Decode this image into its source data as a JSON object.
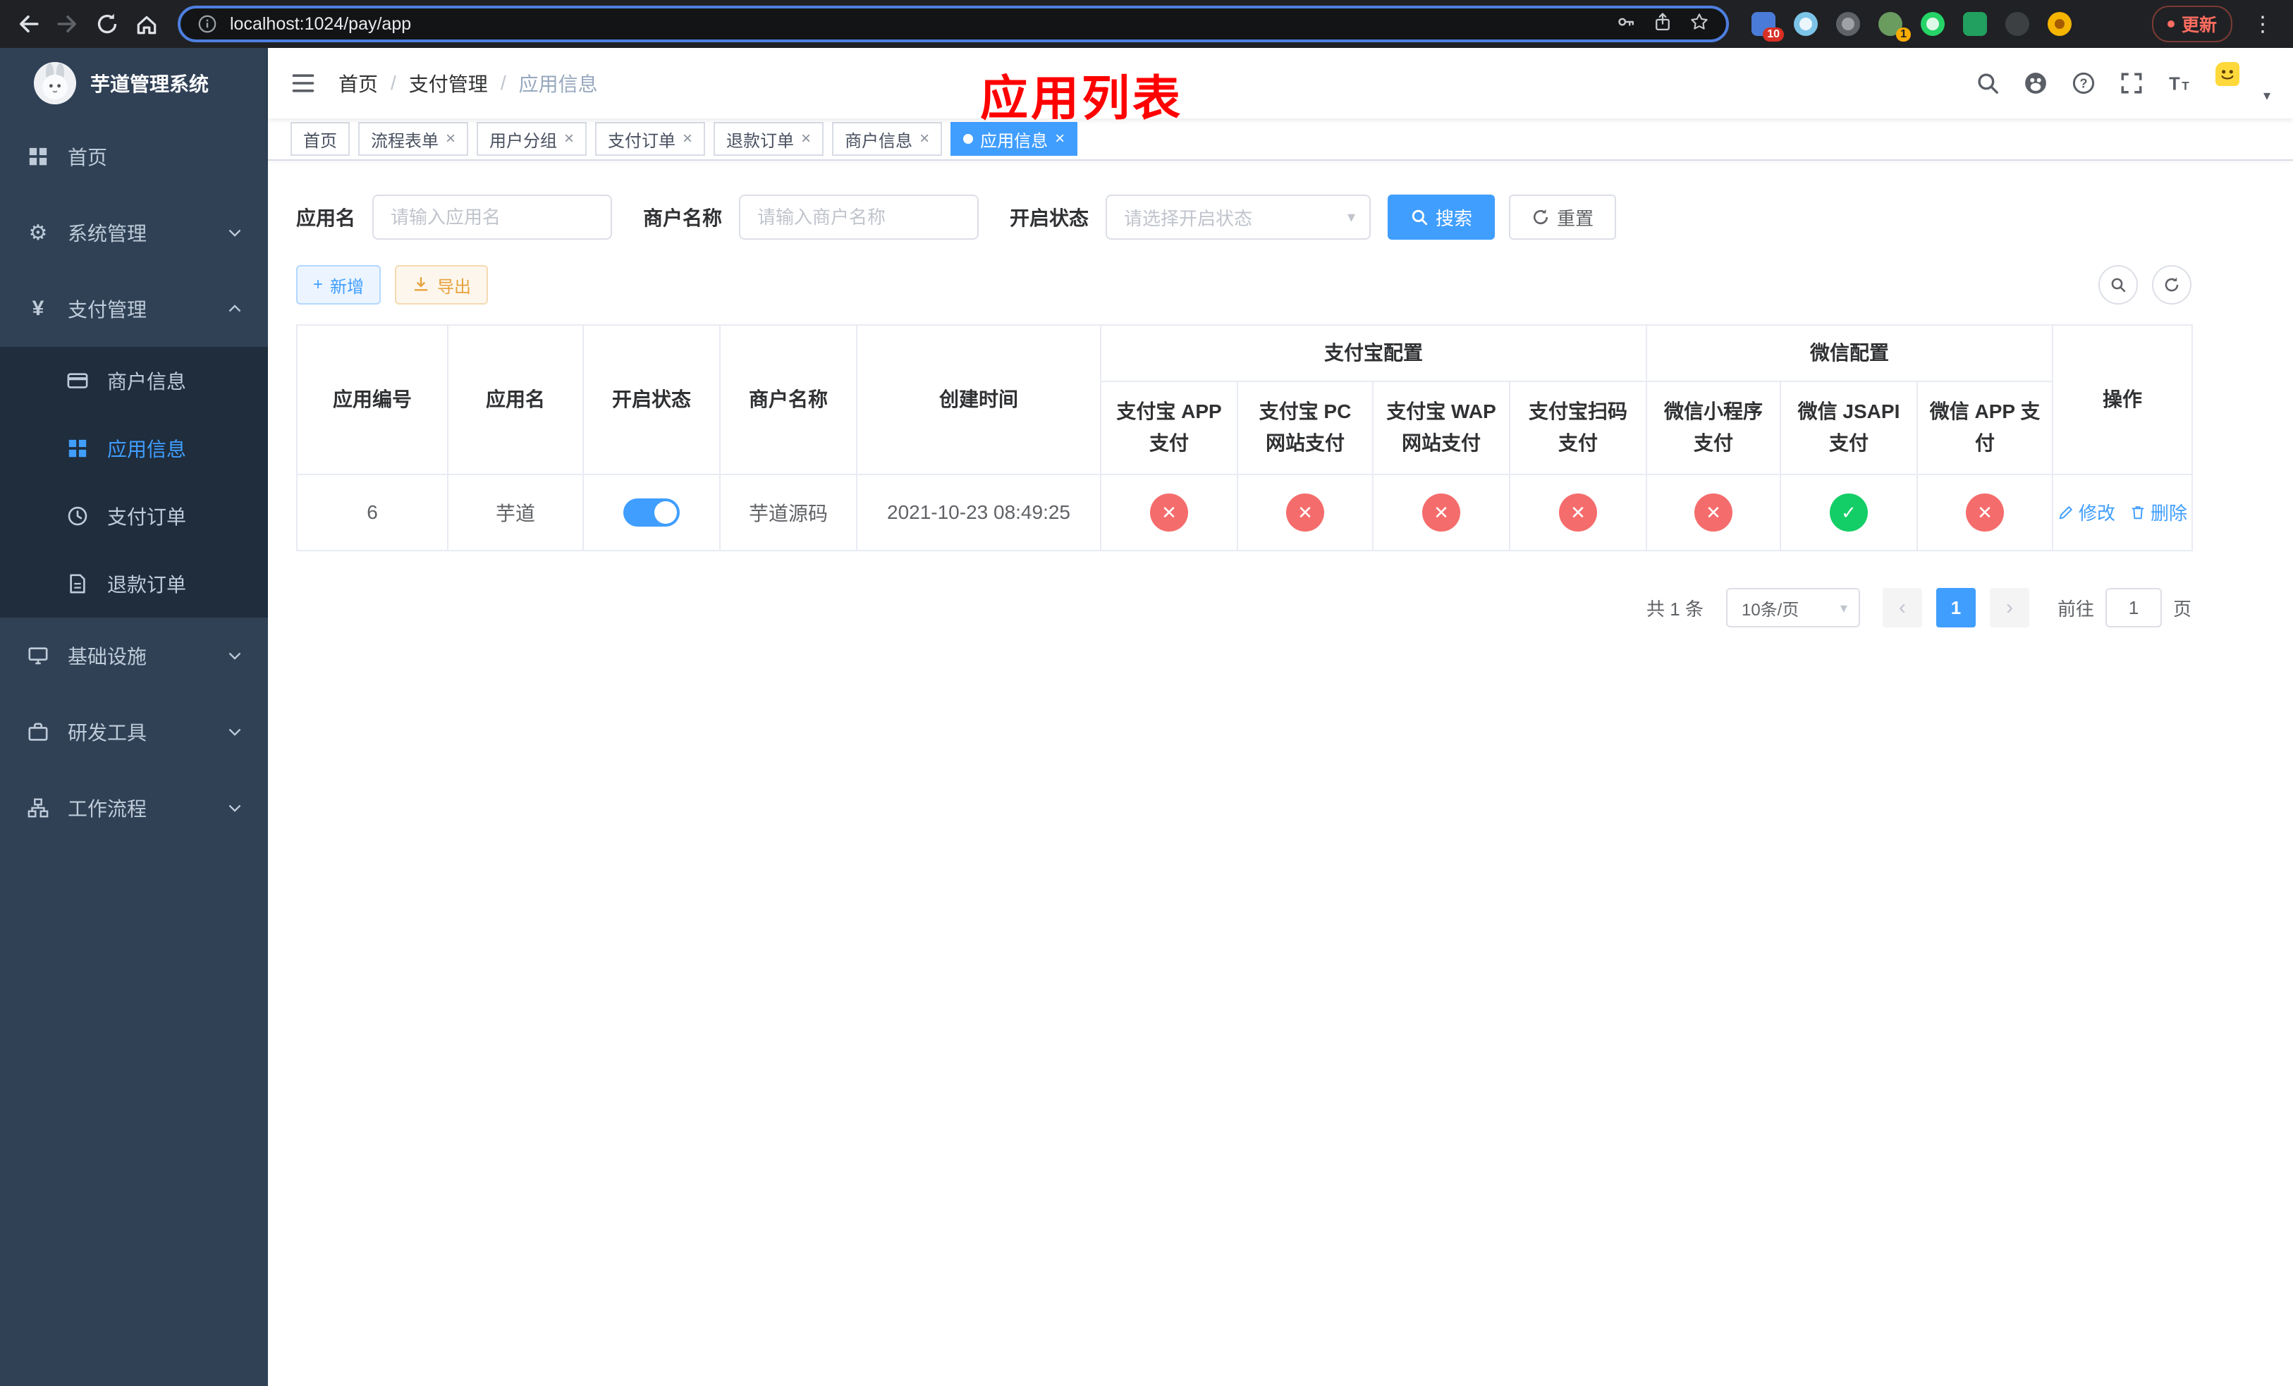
{
  "browser": {
    "url": "localhost:1024/pay/app",
    "update_label": "更新",
    "ext_badge_grid": "10",
    "ext_badge_avatar": "1"
  },
  "sidebar": {
    "title": "芋道管理系统",
    "items": {
      "home": "首页",
      "system": "系统管理",
      "pay": "支付管理",
      "infra": "基础设施",
      "dev": "研发工具",
      "workflow": "工作流程"
    },
    "pay_children": {
      "merchant": "商户信息",
      "app": "应用信息",
      "order": "支付订单",
      "refund": "退款订单"
    }
  },
  "navbar": {
    "breadcrumb": [
      "首页",
      "支付管理",
      "应用信息"
    ],
    "separator": "/"
  },
  "annotation": "应用列表",
  "tabs": [
    {
      "label": "首页"
    },
    {
      "label": "流程表单"
    },
    {
      "label": "用户分组"
    },
    {
      "label": "支付订单"
    },
    {
      "label": "退款订单"
    },
    {
      "label": "商户信息"
    },
    {
      "label": "应用信息"
    }
  ],
  "filters": {
    "app_name_label": "应用名",
    "app_name_placeholder": "请输入应用名",
    "merchant_label": "商户名称",
    "merchant_placeholder": "请输入商户名称",
    "status_label": "开启状态",
    "status_placeholder": "请选择开启状态",
    "search_label": "搜索",
    "reset_label": "重置"
  },
  "toolbar": {
    "add_label": "新增",
    "export_label": "导出"
  },
  "table": {
    "columns": {
      "id": "应用编号",
      "name": "应用名",
      "status": "开启状态",
      "merchant": "商户名称",
      "created": "创建时间",
      "alipay_group": "支付宝配置",
      "wechat_group": "微信配置",
      "alipay_app": "支付宝 APP 支付",
      "alipay_pc": "支付宝 PC 网站支付",
      "alipay_wap": "支付宝 WAP 网站支付",
      "alipay_qr": "支付宝扫码支付",
      "wx_lite": "微信小程序支付",
      "wx_jsapi": "微信 JSAPI 支付",
      "wx_app": "微信 APP 支付",
      "actions": "操作"
    },
    "row": {
      "id": "6",
      "name": "芋道",
      "status_on": true,
      "merchant": "芋道源码",
      "created": "2021-10-23 08:49:25",
      "pay_status": {
        "alipay_app": false,
        "alipay_pc": false,
        "alipay_wap": false,
        "alipay_qr": false,
        "wx_lite": false,
        "wx_jsapi": true,
        "wx_app": false
      },
      "edit_label": "修改",
      "delete_label": "删除"
    }
  },
  "pagination": {
    "total": "共 1 条",
    "page_size": "10条/页",
    "page": "1",
    "goto_label": "前往",
    "goto_value": "1",
    "goto_suffix": "页"
  },
  "icons": {
    "check": "✓",
    "cross": "✕",
    "close": "×",
    "caret_down": "▾",
    "kebab": "⋮",
    "prev": "‹",
    "next": "›",
    "plus": "+"
  },
  "colors": {
    "primary": "#409eff",
    "danger": "#f56c6c",
    "success": "#13ce66",
    "sidebar_bg": "#304156",
    "submenu_bg": "#1f2d3d",
    "annotation": "#ff0000"
  }
}
